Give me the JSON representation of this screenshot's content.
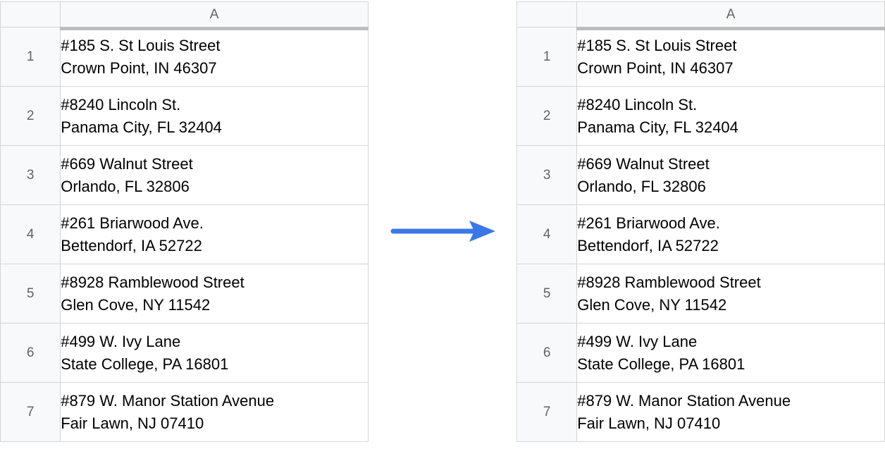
{
  "left": {
    "column_header": "A",
    "rows": [
      {
        "num": "1",
        "line1": "#185  S.   St Louis Street",
        "line2": "Crown Point,   IN 46307"
      },
      {
        "num": "2",
        "line1": "#8240  Lincoln St.",
        "line2": "Panama   City,   FL 32404"
      },
      {
        "num": "3",
        "line1": "#669 Walnut   Street",
        "line2": "Orlando,   FL 32806"
      },
      {
        "num": "4",
        "line1": "#261 Briarwood   Ave.",
        "line2": "Bettendorf,   IA 52722"
      },
      {
        "num": "5",
        "line1": "#8928 Ramblewood Street",
        "line2": "Glen   Cove,   NY 11542"
      },
      {
        "num": "6",
        "line1": "#499   W. Ivy   Lane",
        "line2": "State College,   PA 16801"
      },
      {
        "num": "7",
        "line1": "#879   W. Manor Station Avenue",
        "line2": "Fair Lawn,   NJ 07410"
      }
    ]
  },
  "right": {
    "column_header": "A",
    "rows": [
      {
        "num": "1",
        "line1": "#185 S. St Louis Street",
        "line2": "Crown Point, IN 46307"
      },
      {
        "num": "2",
        "line1": "#8240 Lincoln St.",
        "line2": "Panama City, FL 32404"
      },
      {
        "num": "3",
        "line1": "#669 Walnut Street",
        "line2": "Orlando, FL 32806"
      },
      {
        "num": "4",
        "line1": "#261 Briarwood Ave.",
        "line2": "Bettendorf, IA 52722"
      },
      {
        "num": "5",
        "line1": "#8928 Ramblewood Street",
        "line2": "Glen Cove, NY 11542"
      },
      {
        "num": "6",
        "line1": "#499 W. Ivy Lane",
        "line2": "State College, PA 16801"
      },
      {
        "num": "7",
        "line1": "#879 W. Manor Station Avenue",
        "line2": "Fair Lawn, NJ 07410"
      }
    ]
  },
  "arrow_color": "#3b78e7"
}
